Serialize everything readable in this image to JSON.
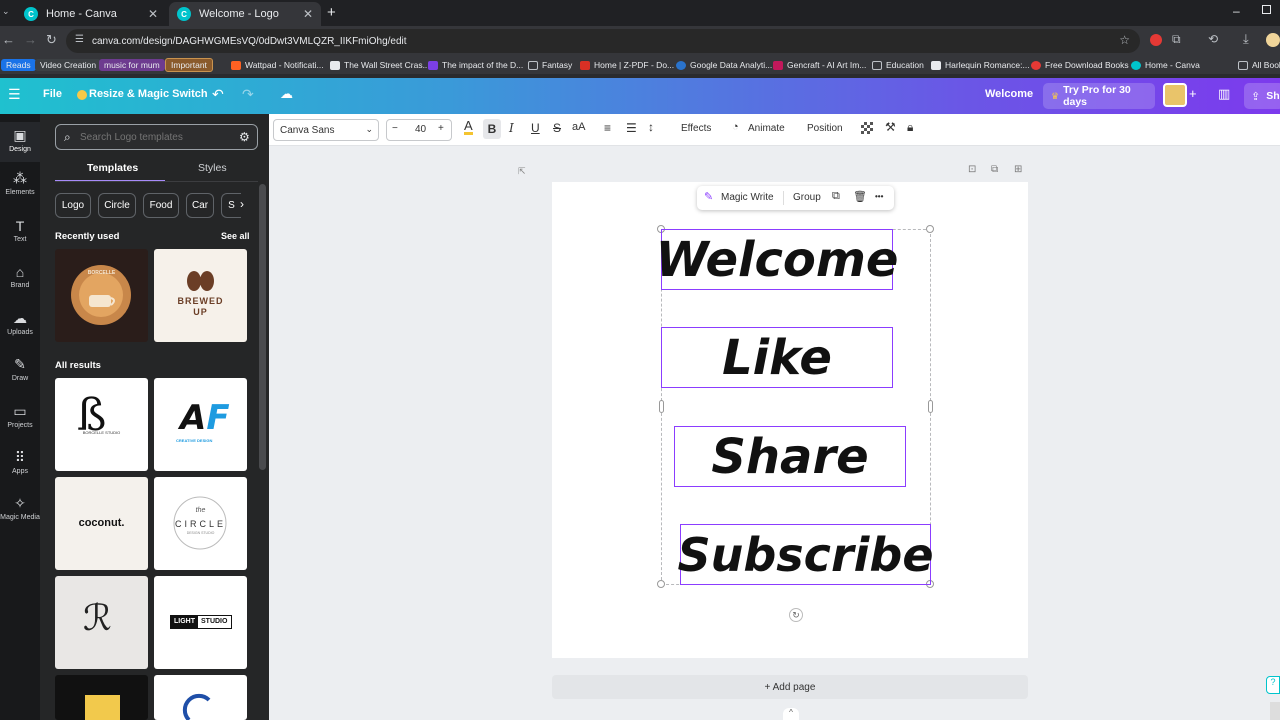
{
  "browser": {
    "tabs": [
      {
        "title": "Home - Canva",
        "active": false
      },
      {
        "title": "Welcome - Logo",
        "active": true
      }
    ],
    "new_tab": "+",
    "url": "canva.com/design/DAGHWGMEsVQ/0dDwt3VMLQZR_IIKFmiOhg/edit",
    "bookmarks": [
      "Reads",
      "Video Creation",
      "music for mum",
      "Important",
      "Wattpad - Notificati...",
      "The Wall Street Cras...",
      "The impact of the D...",
      "Fantasy",
      "Home | Z-PDF - Do...",
      "Google Data Analyti...",
      "Gencraft - AI Art Im...",
      "Education",
      "Harlequin Romance:...",
      "Free Download Books",
      "Home - Canva",
      "All Book"
    ]
  },
  "header": {
    "file": "File",
    "resize": "Resize & Magic Switch",
    "doc_title": "Welcome",
    "pro": "Try Pro for 30 days",
    "share": "Sh"
  },
  "rail": [
    "Design",
    "Elements",
    "Text",
    "Brand",
    "Uploads",
    "Draw",
    "Projects",
    "Apps",
    "Magic Media"
  ],
  "panel": {
    "search_placeholder": "Search Logo templates",
    "tab_templates": "Templates",
    "tab_styles": "Styles",
    "chips": [
      "Logo",
      "Circle",
      "Food",
      "Car",
      "S"
    ],
    "recently_used": "Recently used",
    "see_all": "See all",
    "all_results": "All results",
    "thumbs": {
      "borcelle": "BORCELLE",
      "brewed": "BREWED",
      "up": "UP",
      "bc_sub": "BORCELLE STUDIO",
      "af_sub": "CREATIVE DESIGN",
      "coconut": "coconut.",
      "circle": "CIRCLE",
      "circle_the": "the",
      "circle_sub": "DESIGN STUDIO",
      "light": "LIGHT",
      "studio": "STUDIO"
    }
  },
  "format": {
    "font": "Canva Sans",
    "size": "40",
    "minus": "−",
    "plus": "+",
    "bold": "B",
    "italic": "I",
    "underline": "U",
    "strike": "S",
    "case": "aA",
    "effects": "Effects",
    "animate": "Animate",
    "position": "Position"
  },
  "floating": {
    "magic_write": "Magic Write",
    "group": "Group",
    "more": "•••"
  },
  "canvas": {
    "texts": [
      "Welcome",
      "Like",
      "Share",
      "Subscribe"
    ],
    "add_page": "+ Add page"
  },
  "colors": {
    "accent": "#8b3dff",
    "brand": "#00c4cc"
  }
}
